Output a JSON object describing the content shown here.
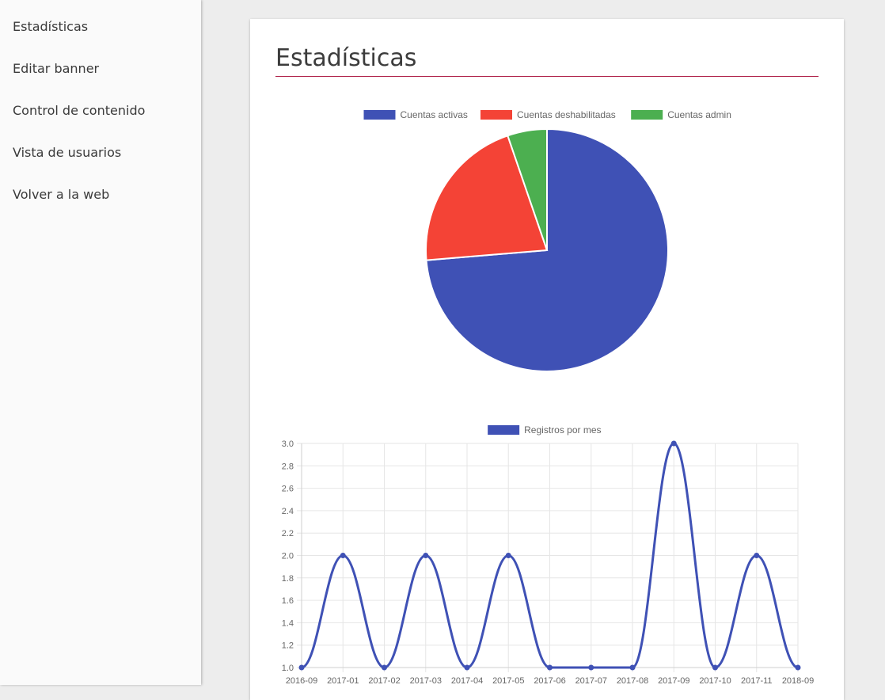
{
  "sidebar": {
    "items": [
      {
        "label": "Estadísticas"
      },
      {
        "label": "Editar banner"
      },
      {
        "label": "Control de contenido"
      },
      {
        "label": "Vista de usuarios"
      },
      {
        "label": "Volver a la web"
      }
    ]
  },
  "main": {
    "title": "Estadísticas"
  },
  "chart_data": [
    {
      "type": "pie",
      "legend_position": "top",
      "labels": [
        "Cuentas activas",
        "Cuentas deshabilitadas",
        "Cuentas admin"
      ],
      "values": [
        14,
        4,
        1
      ],
      "colors": [
        "#3f51b5",
        "#f44336",
        "#4caf50"
      ]
    },
    {
      "type": "line",
      "legend_position": "top",
      "categories": [
        "2016-09",
        "2017-01",
        "2017-02",
        "2017-03",
        "2017-04",
        "2017-05",
        "2017-06",
        "2017-07",
        "2017-08",
        "2017-09",
        "2017-10",
        "2017-11",
        "2018-09"
      ],
      "series": [
        {
          "name": "Registros por mes",
          "values": [
            1,
            2,
            1,
            2,
            1,
            2,
            1,
            1,
            1,
            3,
            1,
            2,
            1
          ],
          "color": "#3f51b5"
        }
      ],
      "ylim": [
        1.0,
        3.0
      ],
      "yticks": [
        "1.0",
        "1.2",
        "1.4",
        "1.6",
        "1.8",
        "2.0",
        "2.2",
        "2.4",
        "2.6",
        "2.8",
        "3.0"
      ],
      "grid": true
    }
  ]
}
